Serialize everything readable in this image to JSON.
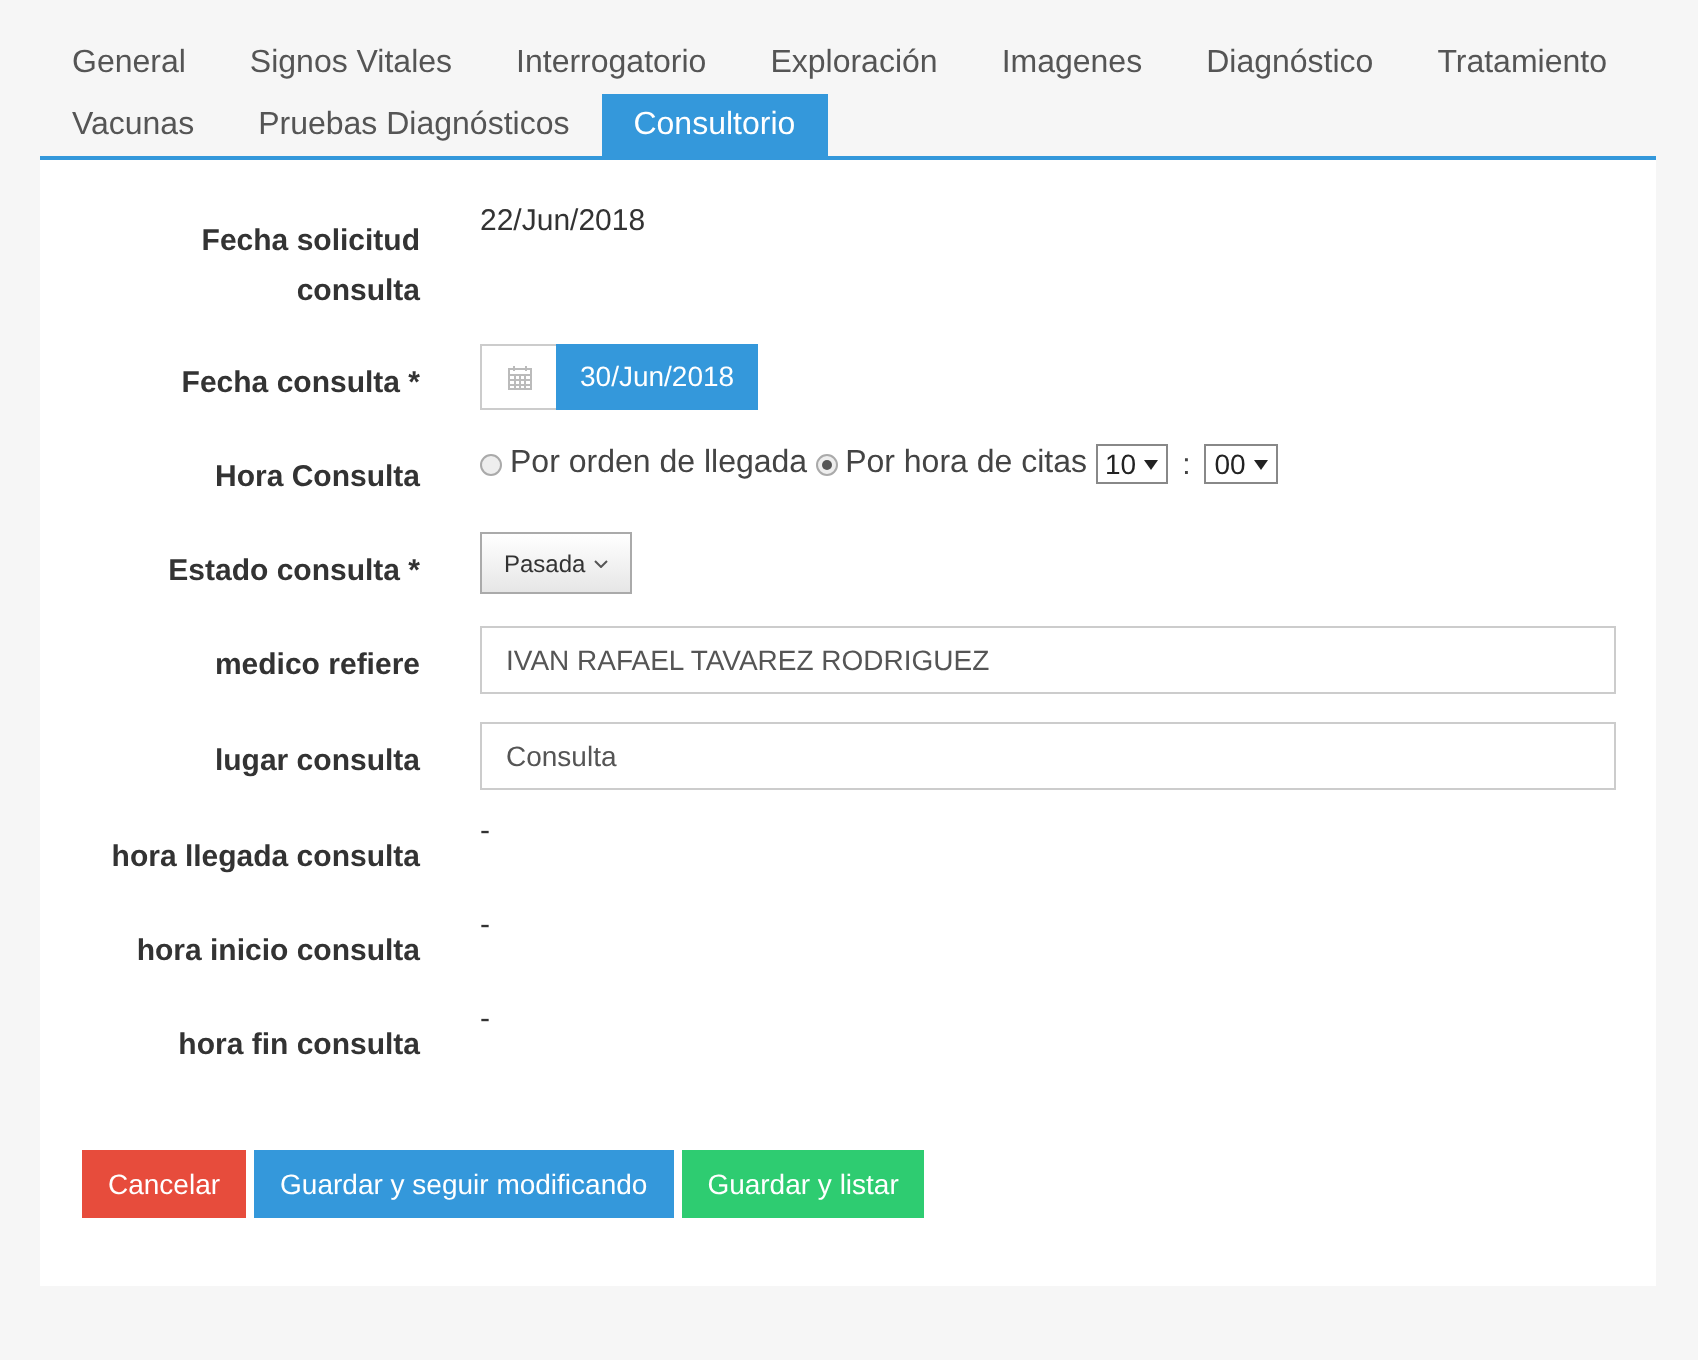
{
  "tabs": [
    {
      "label": "General",
      "selected": false
    },
    {
      "label": "Signos Vitales",
      "selected": false
    },
    {
      "label": "Interrogatorio",
      "selected": false
    },
    {
      "label": "Exploración",
      "selected": false
    },
    {
      "label": "Imagenes",
      "selected": false
    },
    {
      "label": "Diagnóstico",
      "selected": false
    },
    {
      "label": "Tratamiento",
      "selected": false
    },
    {
      "label": "Vacunas",
      "selected": false
    },
    {
      "label": "Pruebas Diagnósticos",
      "selected": false
    },
    {
      "label": "Consultorio",
      "selected": true
    }
  ],
  "form": {
    "rows": [
      {
        "kind": "text",
        "label": "Fecha solicitud consulta",
        "value": "22/Jun/2018"
      },
      {
        "kind": "date",
        "label": "Fecha consulta *",
        "value": "30/Jun/2018"
      },
      {
        "kind": "radio",
        "label": "Hora Consulta",
        "options": [
          {
            "label": "Por orden de llegada",
            "selected": false
          },
          {
            "label": "Por hora de citas",
            "selected": true
          }
        ],
        "hour": "10",
        "separator": ":",
        "minute": "00"
      },
      {
        "kind": "dropdown",
        "label": "Estado consulta *",
        "value": "Pasada"
      },
      {
        "kind": "input",
        "label": "medico refiere",
        "value": "IVAN RAFAEL TAVAREZ RODRIGUEZ"
      },
      {
        "kind": "input",
        "label": "lugar consulta",
        "value": "Consulta"
      },
      {
        "kind": "text",
        "label": "hora llegada consulta",
        "value": "-"
      },
      {
        "kind": "text",
        "label": "hora inicio consulta",
        "value": "-"
      },
      {
        "kind": "text",
        "label": "hora fin consulta",
        "value": "-"
      }
    ]
  },
  "buttons": [
    {
      "label": "Cancelar",
      "color": "#e74c3c"
    },
    {
      "label": "Guardar y seguir modificando",
      "color": "#3498db"
    },
    {
      "label": "Guardar y listar",
      "color": "#2ecc71"
    }
  ]
}
